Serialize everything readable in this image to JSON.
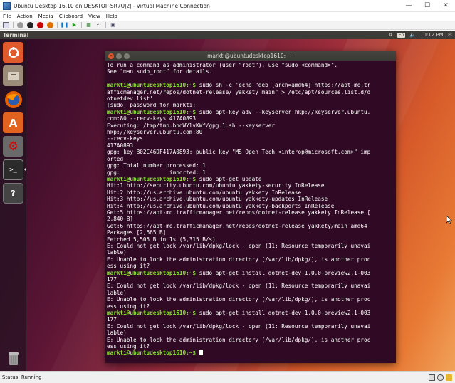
{
  "host": {
    "title": "Ubuntu Desktop 16.10 on DESKTOP-SR7UJ2J - Virtual Machine Connection",
    "menu": [
      "File",
      "Action",
      "Media",
      "Clipboard",
      "View",
      "Help"
    ],
    "status": "Status: Running"
  },
  "panel": {
    "app_name": "Terminal",
    "keyboard": "En",
    "clock": "10:12 PM"
  },
  "terminal": {
    "title": "markti@ubuntudesktop1610: ~",
    "lines": [
      {
        "t": "To run a command as administrator (user \"root\"), use \"sudo <command>\"."
      },
      {
        "t": "See \"man sudo_root\" for details."
      },
      {
        "t": ""
      },
      {
        "p": "markti@ubuntudesktop1610:~$",
        "t": " sudo sh -c 'echo \"deb [arch=amd64] https://apt-mo.tr"
      },
      {
        "t": "afficmanager.net/repos/dotnet-release/ yakkety main\" > /etc/apt/sources.list.d/d"
      },
      {
        "t": "otnetdev.list'"
      },
      {
        "t": "[sudo] password for markti:"
      },
      {
        "p": "markti@ubuntudesktop1610:~$",
        "t": " sudo apt-key adv --keyserver hkp://keyserver.ubuntu."
      },
      {
        "t": "com:80 --recv-keys 417A0893"
      },
      {
        "t": "Executing: /tmp/tmp.bhqWYlvKWf/gpg.1.sh --keyserver"
      },
      {
        "t": "hkp://keyserver.ubuntu.com:80"
      },
      {
        "t": "--recv-keys"
      },
      {
        "t": "417A0893"
      },
      {
        "t": "gpg: key B02C46DF417A0893: public key \"MS Open Tech <interop@microsoft.com>\" imp"
      },
      {
        "t": "orted"
      },
      {
        "t": "gpg: Total number processed: 1"
      },
      {
        "t": "gpg:               imported: 1"
      },
      {
        "p": "markti@ubuntudesktop1610:~$",
        "t": " sudo apt-get update"
      },
      {
        "t": "Hit:1 http://security.ubuntu.com/ubuntu yakkety-security InRelease"
      },
      {
        "t": "Hit:2 http://us.archive.ubuntu.com/ubuntu yakkety InRelease"
      },
      {
        "t": "Hit:3 http://us.archive.ubuntu.com/ubuntu yakkety-updates InRelease"
      },
      {
        "t": "Hit:4 http://us.archive.ubuntu.com/ubuntu yakkety-backports InRelease"
      },
      {
        "t": "Get:5 https://apt-mo.trafficmanager.net/repos/dotnet-release yakkety InRelease ["
      },
      {
        "t": "2,840 B]"
      },
      {
        "t": "Get:6 https://apt-mo.trafficmanager.net/repos/dotnet-release yakkety/main amd64"
      },
      {
        "t": "Packages [2,665 B]"
      },
      {
        "t": "Fetched 5,505 B in 1s (5,315 B/s)"
      },
      {
        "t": "E: Could not get lock /var/lib/dpkg/lock - open (11: Resource temporarily unavai"
      },
      {
        "t": "lable)"
      },
      {
        "t": "E: Unable to lock the administration directory (/var/lib/dpkg/), is another proc"
      },
      {
        "t": "ess using it?"
      },
      {
        "p": "markti@ubuntudesktop1610:~$",
        "t": " sudo apt-get install dotnet-dev-1.0.0-preview2.1-003"
      },
      {
        "t": "177"
      },
      {
        "t": "E: Could not get lock /var/lib/dpkg/lock - open (11: Resource temporarily unavai"
      },
      {
        "t": "lable)"
      },
      {
        "t": "E: Unable to lock the administration directory (/var/lib/dpkg/), is another proc"
      },
      {
        "t": "ess using it?"
      },
      {
        "p": "markti@ubuntudesktop1610:~$",
        "t": " sudo apt-get install dotnet-dev-1.0.0-preview2.1-003"
      },
      {
        "t": "177"
      },
      {
        "t": "E: Could not get lock /var/lib/dpkg/lock - open (11: Resource temporarily unavai"
      },
      {
        "t": "lable)"
      },
      {
        "t": "E: Unable to lock the administration directory (/var/lib/dpkg/), is another proc"
      },
      {
        "t": "ess using it?"
      },
      {
        "p": "markti@ubuntudesktop1610:~$",
        "t": " ",
        "cursor": true
      }
    ]
  },
  "launcher": [
    {
      "name": "dash-icon",
      "color": "#e05a2b"
    },
    {
      "name": "files-icon",
      "color": "#9a8c78"
    },
    {
      "name": "firefox-icon",
      "color": "#e66000"
    },
    {
      "name": "software-center-icon",
      "color": "#e2621f"
    },
    {
      "name": "system-settings-icon",
      "color": "#6a6a6a"
    },
    {
      "name": "terminal-icon",
      "color": "#2b2b2b"
    },
    {
      "name": "help-icon",
      "color": "#444444"
    },
    {
      "name": "trash-icon",
      "color": "#777777"
    }
  ],
  "colors": {
    "terminal_bg": "#300a24",
    "prompt": "#8ae234",
    "panel": "#3c3b37"
  }
}
